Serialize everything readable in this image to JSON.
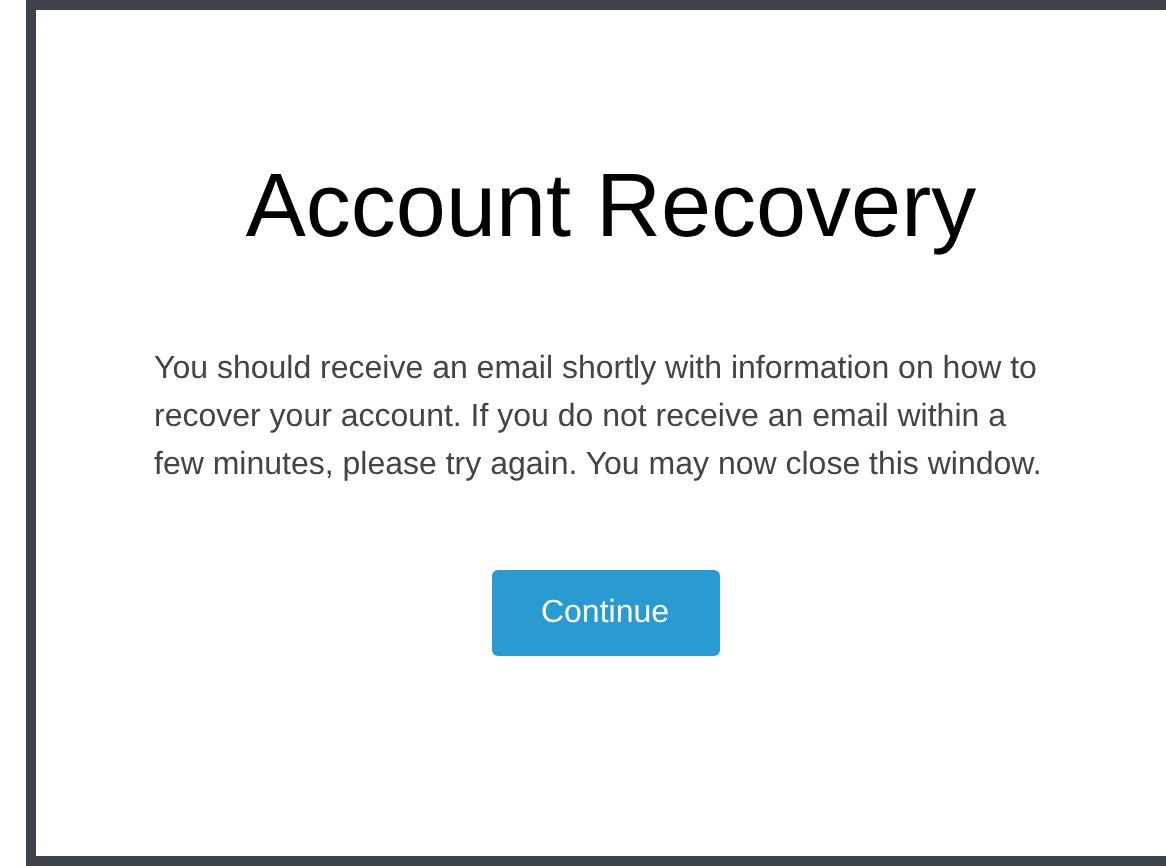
{
  "dialog": {
    "title": "Account Recovery",
    "message": "You should receive an email shortly with information on how to recover your account. If you do not receive an email within a few minutes, please try again. You may now close this window.",
    "buttons": [
      "Continue"
    ]
  }
}
